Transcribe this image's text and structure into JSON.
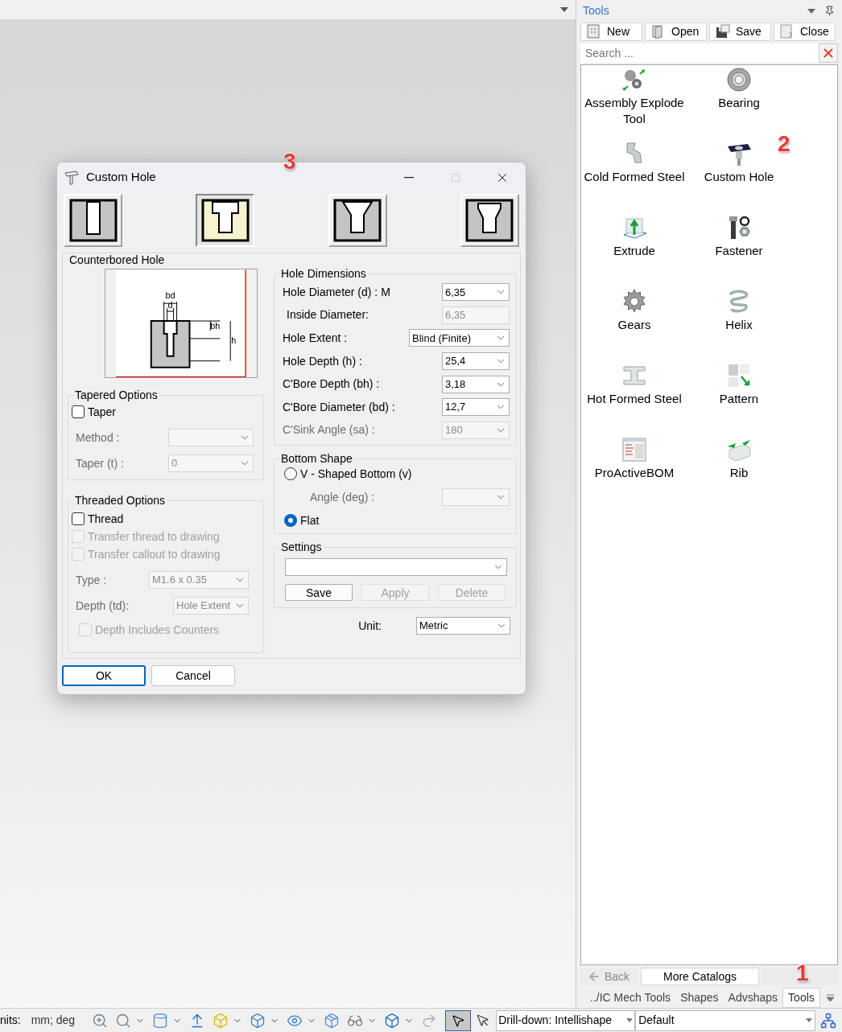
{
  "dialog": {
    "title": "Custom Hole",
    "hole_types": [
      {
        "kind": "simple",
        "selected": false
      },
      {
        "kind": "counterbore",
        "selected": true
      },
      {
        "kind": "countersink",
        "selected": false
      },
      {
        "kind": "counterdrill",
        "selected": false
      }
    ],
    "section_title": "Counterbored Hole",
    "diagram_labels": [
      "bd",
      "d",
      "bh",
      "h"
    ],
    "tapered": {
      "title": "Tapered Options",
      "checkbox": {
        "label": "Taper",
        "checked": false,
        "disabled": false
      },
      "fields": [
        {
          "label": "Method :",
          "disabled": true
        },
        {
          "label": "Taper (t) :",
          "value": "0",
          "disabled": true
        }
      ]
    },
    "threaded": {
      "title": "Threaded Options",
      "checkboxes": [
        {
          "label": "Thread",
          "checked": false,
          "disabled": false
        },
        {
          "label": "Transfer thread to drawing",
          "checked": false,
          "disabled": true
        },
        {
          "label": "Transfer callout to drawing",
          "checked": false,
          "disabled": true
        }
      ],
      "fields": [
        {
          "label": "Type :",
          "value": "M1.6 x 0.35",
          "disabled": true
        },
        {
          "label": "Depth (td):",
          "value": "Hole Extent",
          "disabled": true
        }
      ],
      "extra_checkbox": {
        "label": "Depth Includes Counters",
        "checked": false,
        "disabled": true
      }
    },
    "dimensions": {
      "title": "Hole Dimensions",
      "rows": [
        {
          "label": "Hole Diameter (d) : M",
          "value": "6,35",
          "kind": "combo",
          "disabled": false
        },
        {
          "label": "Inside Diameter:",
          "value": "6,35",
          "kind": "readonly",
          "disabled": true
        },
        {
          "label": "Hole Extent :",
          "value": "Blind (Finite)",
          "kind": "wide",
          "disabled": false
        },
        {
          "label": "Hole Depth (h) :",
          "value": "25,4",
          "kind": "combo",
          "disabled": false
        },
        {
          "label": "C'Bore Depth (bh) :",
          "value": "3,18",
          "kind": "combo",
          "disabled": false
        },
        {
          "label": "C'Bore Diameter (bd) :",
          "value": "12,7",
          "kind": "combo",
          "disabled": false
        },
        {
          "label": "C'Sink Angle (sa) :",
          "value": "180",
          "kind": "combo",
          "disabled": true
        }
      ]
    },
    "bottom_shape": {
      "title": "Bottom Shape",
      "options": [
        {
          "label": "V - Shaped Bottom (v)",
          "selected": false
        },
        {
          "label": "Flat",
          "selected": true
        }
      ],
      "angle": {
        "label": "Angle (deg) :",
        "disabled": true
      }
    },
    "settings": {
      "title": "Settings",
      "buttons": [
        {
          "label": "Save",
          "disabled": false
        },
        {
          "label": "Apply",
          "disabled": true
        },
        {
          "label": "Delete",
          "disabled": true
        }
      ]
    },
    "unit": {
      "label": "Unit:",
      "value": "Metric"
    },
    "buttons": [
      {
        "label": "OK",
        "default": true
      },
      {
        "label": "Cancel",
        "default": false
      }
    ]
  },
  "tools_panel": {
    "title": "Tools",
    "buttons": [
      {
        "label": "New",
        "kind": "new"
      },
      {
        "label": "Open",
        "kind": "open"
      },
      {
        "label": "Save",
        "kind": "save"
      },
      {
        "label": "Close",
        "kind": "close"
      }
    ],
    "search": {
      "placeholder": "Search ..."
    },
    "items": [
      {
        "label": "Assembly Explode Tool",
        "kind": "explode"
      },
      {
        "label": "Bearing",
        "kind": "bearing"
      },
      {
        "label": "Cold Formed Steel",
        "kind": "coldsteel"
      },
      {
        "label": "Custom Hole",
        "kind": "hole"
      },
      {
        "label": "Extrude",
        "kind": "extrude"
      },
      {
        "label": "Fastener",
        "kind": "fastener"
      },
      {
        "label": "Gears",
        "kind": "gear"
      },
      {
        "label": "Helix",
        "kind": "helix"
      },
      {
        "label": "Hot Formed Steel",
        "kind": "hotsteel"
      },
      {
        "label": "Pattern",
        "kind": "pattern"
      },
      {
        "label": "ProActiveBOM",
        "kind": "bom"
      },
      {
        "label": "Rib",
        "kind": "rib"
      }
    ],
    "back": {
      "label": "Back",
      "disabled": true
    },
    "more": {
      "label": "More Catalogs"
    },
    "tabs": [
      {
        "label": "../IC Mech Tools",
        "selected": false
      },
      {
        "label": "Shapes",
        "selected": false
      },
      {
        "label": "Advshaps",
        "selected": false
      },
      {
        "label": "Tools",
        "selected": true
      }
    ]
  },
  "status_bar": {
    "units_label": "nits:",
    "units_value": "mm; deg",
    "drilldown": "Drill-down: Intellishape",
    "style": "Default"
  },
  "annotations": [
    {
      "label": "3"
    },
    {
      "label": "2"
    },
    {
      "label": "1"
    }
  ]
}
